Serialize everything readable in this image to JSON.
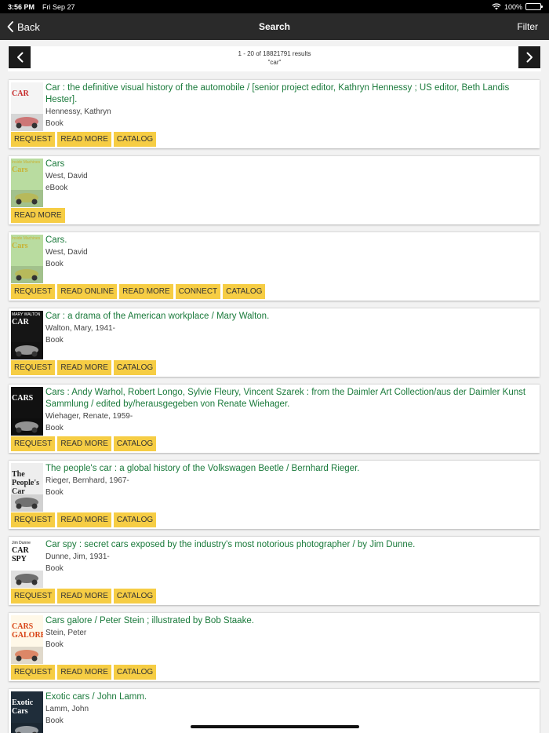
{
  "status": {
    "time": "3:56 PM",
    "date": "Fri Sep 27",
    "battery": "100%"
  },
  "nav": {
    "back_label": "Back",
    "title": "Search",
    "filter_label": "Filter"
  },
  "pager": {
    "range": "1 - 20 of 18821791 results",
    "query": "\"car\""
  },
  "results": [
    {
      "title": "Car : the definitive visual history of the automobile / [senior project editor, Kathryn Hennessy ; US editor, Beth Landis Hester].",
      "author": "Hennessy, Kathryn",
      "format": "Book",
      "actions": [
        "REQUEST",
        "READ MORE",
        "CATALOG"
      ],
      "cover": {
        "text": "CAR",
        "subtext": "",
        "bg": "#f4f4f4",
        "fg": "#c62828"
      }
    },
    {
      "title": "Cars",
      "author": "West, David",
      "format": "eBook",
      "actions": [
        "READ MORE"
      ],
      "cover": {
        "text": "Cars",
        "subtext": "Inside Machines",
        "bg": "#b9dca0",
        "fg": "#c9b233"
      }
    },
    {
      "title": "Cars.",
      "author": "West, David",
      "format": "Book",
      "actions": [
        "REQUEST",
        "READ ONLINE",
        "READ MORE",
        "CONNECT",
        "CATALOG"
      ],
      "cover": {
        "text": "Cars",
        "subtext": "Inside Machines",
        "bg": "#b9dca0",
        "fg": "#c9b233"
      }
    },
    {
      "title": "Car : a drama of the American workplace / Mary Walton.",
      "author": "Walton, Mary, 1941-",
      "format": "Book",
      "actions": [
        "REQUEST",
        "READ MORE",
        "CATALOG"
      ],
      "cover": {
        "text": "CAR",
        "subtext": "MARY WALTON",
        "bg": "#151515",
        "fg": "#ffffff"
      }
    },
    {
      "title": "Cars : Andy Warhol, Robert Longo, Sylvie Fleury, Vincent Szarek : from the Daimler Art Collection/aus der Daimler Kunst Sammlung / edited by/herausgegeben von Renate Wiehager.",
      "author": "Wiehager, Renate, 1959-",
      "format": "Book",
      "actions": [
        "REQUEST",
        "READ MORE",
        "CATALOG"
      ],
      "cover": {
        "text": "CARS",
        "subtext": "",
        "bg": "#111111",
        "fg": "#ffffff"
      }
    },
    {
      "title": "The people's car : a global history of the Volkswagen Beetle / Bernhard Rieger.",
      "author": "Rieger, Bernhard, 1967-",
      "format": "Book",
      "actions": [
        "REQUEST",
        "READ MORE",
        "CATALOG"
      ],
      "cover": {
        "text": "The People's Car",
        "subtext": "",
        "bg": "#eeeeee",
        "fg": "#222222"
      }
    },
    {
      "title": "Car spy : secret cars exposed by the industry's most notorious photographer / by Jim Dunne.",
      "author": "Dunne, Jim, 1931-",
      "format": "Book",
      "actions": [
        "REQUEST",
        "READ MORE",
        "CATALOG"
      ],
      "cover": {
        "text": "CAR SPY",
        "subtext": "Jim Dunne",
        "bg": "#ffffff",
        "fg": "#111111"
      }
    },
    {
      "title": "Cars galore / Peter Stein ; illustrated by Bob Staake.",
      "author": "Stein, Peter",
      "format": "Book",
      "actions": [
        "REQUEST",
        "READ MORE",
        "CATALOG"
      ],
      "cover": {
        "text": "CARS GALORE",
        "subtext": "",
        "bg": "#fff8e8",
        "fg": "#d84315"
      }
    },
    {
      "title": "Exotic cars / John Lamm.",
      "author": "Lamm, John",
      "format": "Book",
      "actions": [],
      "cover": {
        "text": "Exotic Cars",
        "subtext": "",
        "bg": "#1f2d3a",
        "fg": "#ffffff"
      }
    }
  ]
}
